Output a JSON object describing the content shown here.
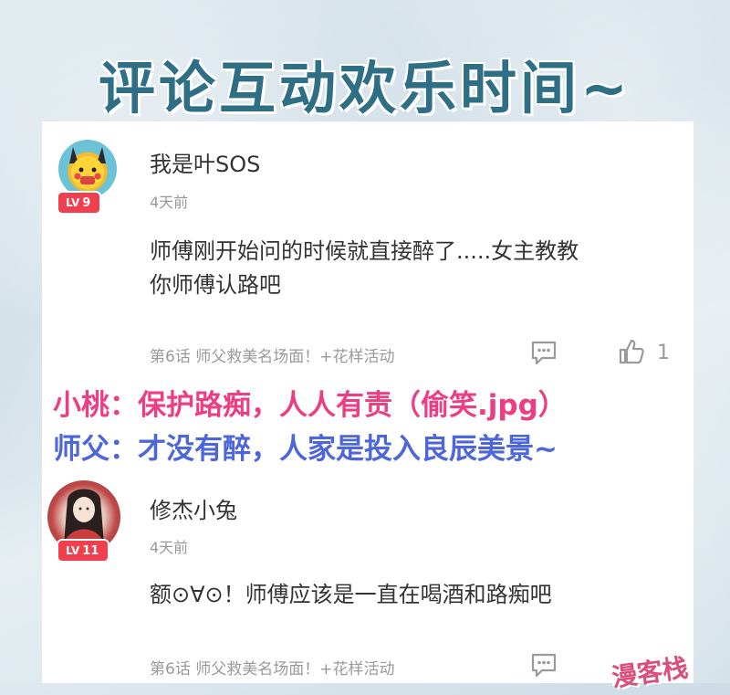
{
  "header": {
    "title": "评论互动欢乐时间~"
  },
  "comments": [
    {
      "username": "我是叶SOS",
      "level_label": "LV",
      "level": "9",
      "time": "4天前",
      "body_lines": [
        "师傅刚开始问的时候就直接醉了.....女主教教",
        "你师傅认路吧"
      ],
      "chapter_link": "第6话 师父救美名场面！+花样活动",
      "likes": "1"
    },
    {
      "username": "修杰小兔",
      "level_label": "LV",
      "level": "11",
      "time": "4天前",
      "body_lines": [
        "额⊙∀⊙！师傅应该是一直在喝酒和路痴吧"
      ],
      "chapter_link": "第6话 师父救美名场面！+花样活动"
    }
  ],
  "captions": {
    "line1": "小桃：保护路痴，人人有责（偷笑.jpg）",
    "line2": "师父：才没有醉，人家是投入良辰美景~"
  },
  "watermark": "漫客栈",
  "colors": {
    "title": "#2f6f86",
    "caption1": "#ec3e84",
    "caption2": "#4d66d9",
    "badge": "#f0404f"
  }
}
